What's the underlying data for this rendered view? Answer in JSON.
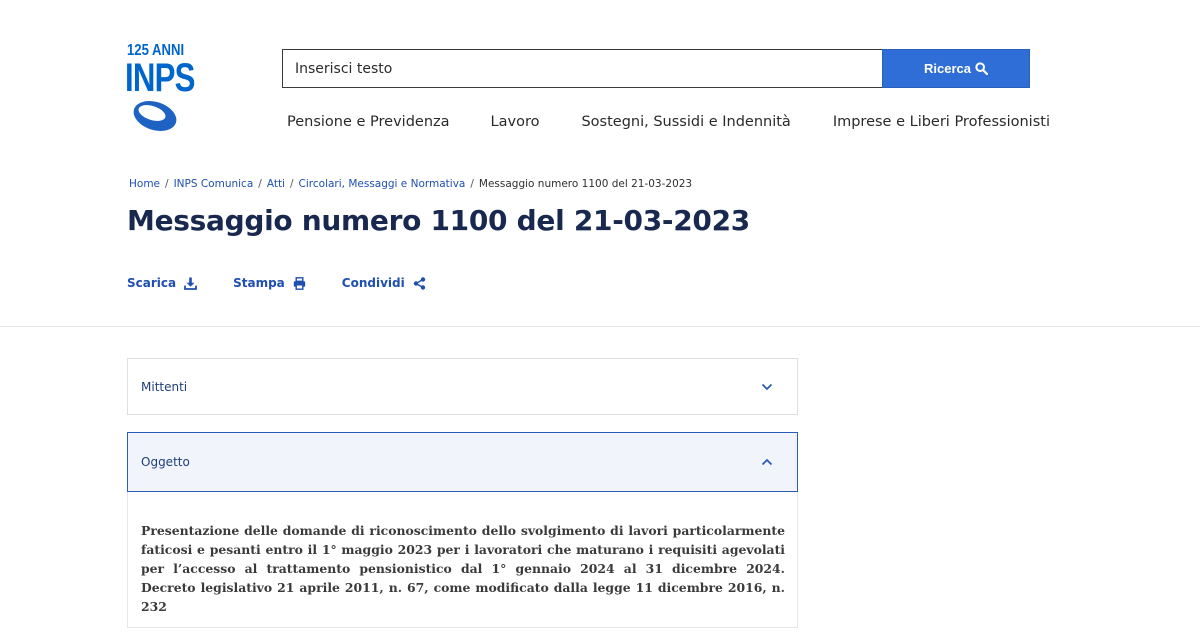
{
  "logo": {
    "anniversary": "125 ANNI",
    "brand": "INPS"
  },
  "search": {
    "placeholder": "Inserisci testo",
    "button_label": "Ricerca"
  },
  "nav": [
    "Pensione e Previdenza",
    "Lavoro",
    "Sostegni, Sussidi e Indennità",
    "Imprese e Liberi Professionisti"
  ],
  "breadcrumb": [
    "Home",
    "INPS Comunica",
    "Atti",
    "Circolari, Messaggi e Normativa",
    "Messaggio numero 1100 del 21-03-2023"
  ],
  "page_title": "Messaggio numero 1100 del 21-03-2023",
  "actions": {
    "download": "Scarica",
    "print": "Stampa",
    "share": "Condividi"
  },
  "accordions": [
    {
      "label": "Mittenti",
      "expanded": false
    },
    {
      "label": "Oggetto",
      "expanded": true
    }
  ],
  "oggetto_text": "Presentazione delle domande di riconoscimento dello svolgimento di lavori particolarmente faticosi e pesanti entro il 1° maggio 2023 per i lavoratori che maturano i requisiti agevolati per l’accesso al trattamento pensionistico dal 1° gennaio 2024 al 31 dicembre 2024. Decreto legislativo 21 aprile 2011, n. 67, come modificato dalla legge 11 dicembre 2016, n. 232",
  "colors": {
    "brand_blue": "#0066cc",
    "button_blue": "#2f6ed6",
    "link_blue": "#1f4fb0",
    "title_navy": "#18284e"
  }
}
